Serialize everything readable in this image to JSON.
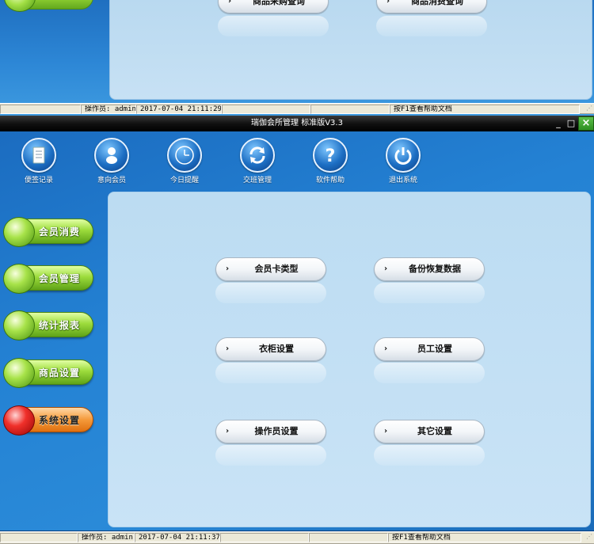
{
  "background_window": {
    "buttons": [
      {
        "label": "商品采购查询"
      },
      {
        "label": "商品消费查询"
      }
    ],
    "statusbar": {
      "operator": "操作员: admin",
      "datetime": "2017-07-04 21:11:29",
      "help": "按F1查看帮助文档"
    }
  },
  "window": {
    "title": "瑞伽会所管理 标准版V3.3",
    "minimize_glyph": "_",
    "maximize_glyph": "□",
    "close_glyph": "×"
  },
  "toolbar": {
    "items": [
      {
        "label": "便签记录",
        "icon": "notepad-icon"
      },
      {
        "label": "意向会员",
        "icon": "member-icon"
      },
      {
        "label": "今日提醒",
        "icon": "clock-icon"
      },
      {
        "label": "交班管理",
        "icon": "refresh-icon"
      },
      {
        "label": "软件帮助",
        "icon": "help-icon"
      },
      {
        "label": "退出系统",
        "icon": "power-icon"
      }
    ]
  },
  "sidebar": {
    "items": [
      {
        "label": "会员消费",
        "active": false
      },
      {
        "label": "会员管理",
        "active": false
      },
      {
        "label": "统计报表",
        "active": false
      },
      {
        "label": "商品设置",
        "active": false
      },
      {
        "label": "系统设置",
        "active": true
      }
    ]
  },
  "functions": {
    "arrow": "›",
    "items": [
      {
        "label": "会员卡类型"
      },
      {
        "label": "备份恢复数据"
      },
      {
        "label": "衣柜设置"
      },
      {
        "label": "员工设置"
      },
      {
        "label": "操作员设置"
      },
      {
        "label": "其它设置"
      }
    ]
  },
  "statusbar": {
    "operator": "操作员: admin",
    "datetime": "2017-07-04 21:11:37",
    "help": "按F1查看帮助文档"
  },
  "colors": {
    "background_blue": "#2482d4",
    "panel_light": "#c9e3f6",
    "sidebar_green": "#9ddc3c",
    "sidebar_active_orange": "#f59a3a",
    "titlebar_black": "#111111",
    "close_green": "#2e8f22"
  }
}
